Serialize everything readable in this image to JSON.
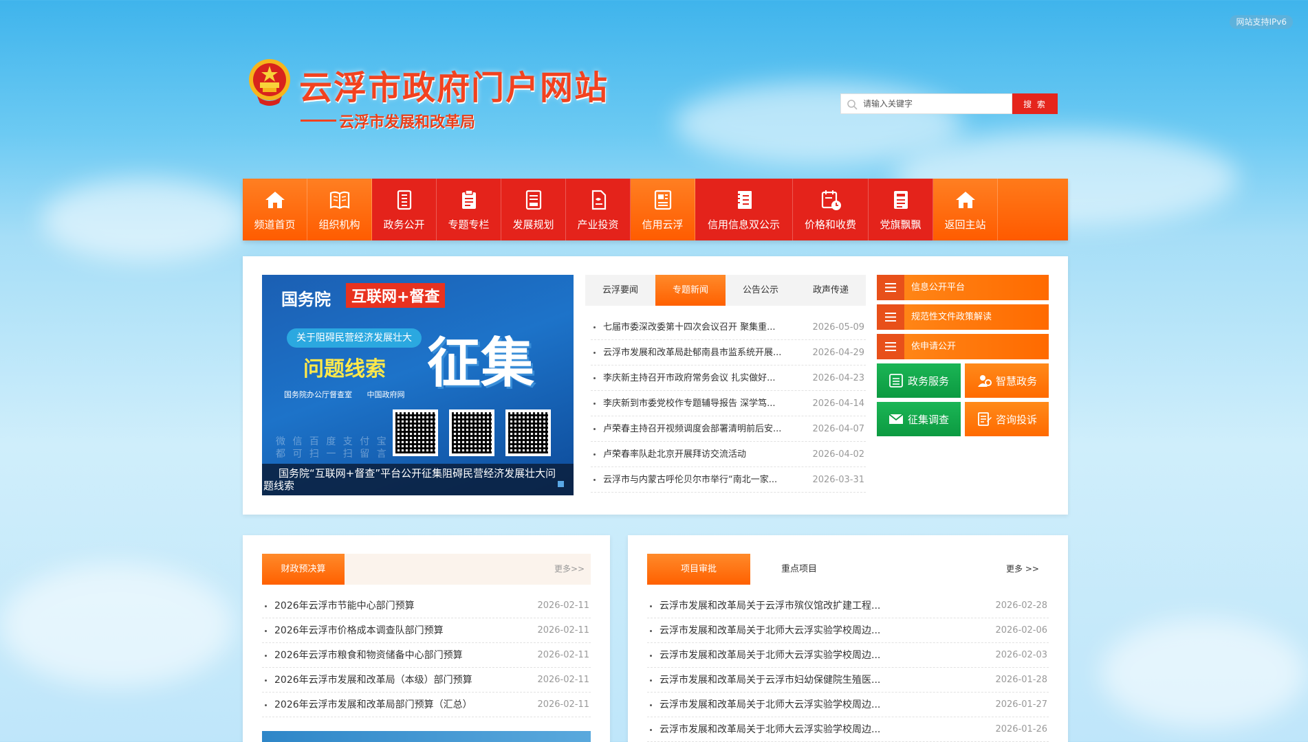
{
  "ipv6_badge": "网站支持IPv6",
  "header": {
    "site_title": "云浮市政府门户网站",
    "sub_title": "云浮市发展和改革局"
  },
  "search": {
    "placeholder": "请输入关键字",
    "button": "搜 索"
  },
  "nav": [
    {
      "label": "频道首页",
      "icon": "home-icon",
      "style": "orange"
    },
    {
      "label": "组织机构",
      "icon": "book-icon",
      "style": "orange"
    },
    {
      "label": "政务公开",
      "icon": "document-icon",
      "style": "red"
    },
    {
      "label": "专题专栏",
      "icon": "clipboard-icon",
      "style": "red"
    },
    {
      "label": "发展规划",
      "icon": "edit-document-icon",
      "style": "red"
    },
    {
      "label": "产业投资",
      "icon": "file-icon",
      "style": "red"
    },
    {
      "label": "信用云浮",
      "icon": "notes-icon",
      "style": "orange"
    },
    {
      "label": "信用信息双公示",
      "icon": "notebook-icon",
      "style": "red"
    },
    {
      "label": "价格和收费",
      "icon": "calendar-clock-icon",
      "style": "red"
    },
    {
      "label": "党旗飘飘",
      "icon": "report-icon",
      "style": "red"
    },
    {
      "label": "返回主站",
      "icon": "home-icon",
      "style": "orange"
    }
  ],
  "banner": {
    "top_text": "国务院",
    "tag": "互联网+督查",
    "pill": "关于阻碍民营经济发展壮大",
    "clue": "问题线索",
    "big": "征集",
    "logo1": "国务院办公厅督查室",
    "logo2": "中国政府网",
    "faint": "微 信  百 度  支 付 宝",
    "faint2": "都 可 扫 一 扫 留 言",
    "caption": "国务院“互联网+督查”平台公开征集阻碍民营经济发展壮大问题线索"
  },
  "tabs": [
    "云浮要闻",
    "专题新闻",
    "公告公示",
    "政声传递"
  ],
  "active_tab": "专题新闻",
  "news": [
    {
      "title": "七届市委深改委第十四次会议召开 聚集重...",
      "date": "2026-05-09"
    },
    {
      "title": "云浮市发展和改革局赴郁南县市监系统开展...",
      "date": "2026-04-29"
    },
    {
      "title": "李庆新主持召开市政府常务会议 扎实做好...",
      "date": "2026-04-23"
    },
    {
      "title": "李庆新到市委党校作专题辅导报告 深学笃...",
      "date": "2026-04-14"
    },
    {
      "title": "卢荣春主持召开视频调度会部署清明前后安...",
      "date": "2026-04-07"
    },
    {
      "title": "卢荣春率队赴北京开展拜访交流活动",
      "date": "2026-04-02"
    },
    {
      "title": "云浮市与内蒙古呼伦贝尔市举行“南北一家...",
      "date": "2026-03-31"
    }
  ],
  "side_bars": [
    "信息公开平台",
    "规范性文件政策解读",
    "依申请公开"
  ],
  "tiles": [
    {
      "label": "政务服务",
      "icon": "list-icon",
      "style": "green"
    },
    {
      "label": "智慧政务",
      "icon": "user-gear-icon",
      "style": "orange"
    },
    {
      "label": "征集调查",
      "icon": "mail-icon",
      "style": "green"
    },
    {
      "label": "咨询投诉",
      "icon": "form-icon",
      "style": "orange"
    }
  ],
  "finance": {
    "tab": "财政预决算",
    "more": "更多>>",
    "items": [
      {
        "title": "2026年云浮市节能中心部门预算",
        "date": "2026-02-11"
      },
      {
        "title": "2026年云浮市价格成本调查队部门预算",
        "date": "2026-02-11"
      },
      {
        "title": "2026年云浮市粮食和物资储备中心部门预算",
        "date": "2026-02-11"
      },
      {
        "title": "2026年云浮市发展和改革局（本级）部门预算",
        "date": "2026-02-11"
      },
      {
        "title": "2026年云浮市发展和改革局部门预算（汇总）",
        "date": "2026-02-11"
      }
    ]
  },
  "projects": {
    "tab": "项目审批",
    "tab2": "重点项目",
    "more": "更多 >>",
    "items": [
      {
        "title": "云浮市发展和改革局关于云浮市殡仪馆改扩建工程...",
        "date": "2026-02-28"
      },
      {
        "title": "云浮市发展和改革局关于北师大云浮实验学校周边...",
        "date": "2026-02-06"
      },
      {
        "title": "云浮市发展和改革局关于北师大云浮实验学校周边...",
        "date": "2026-02-03"
      },
      {
        "title": "云浮市发展和改革局关于云浮市妇幼保健院生殖医...",
        "date": "2026-01-28"
      },
      {
        "title": "云浮市发展和改革局关于北师大云浮实验学校周边...",
        "date": "2026-01-27"
      },
      {
        "title": "云浮市发展和改革局关于北师大云浮实验学校周边...",
        "date": "2026-01-26"
      }
    ]
  },
  "colors": {
    "primary_orange": "#ff6a00",
    "nav_red": "#e4231b",
    "search_red": "#e5251c",
    "tile_green": "#0c9a41",
    "title_red": "#f2421f"
  }
}
